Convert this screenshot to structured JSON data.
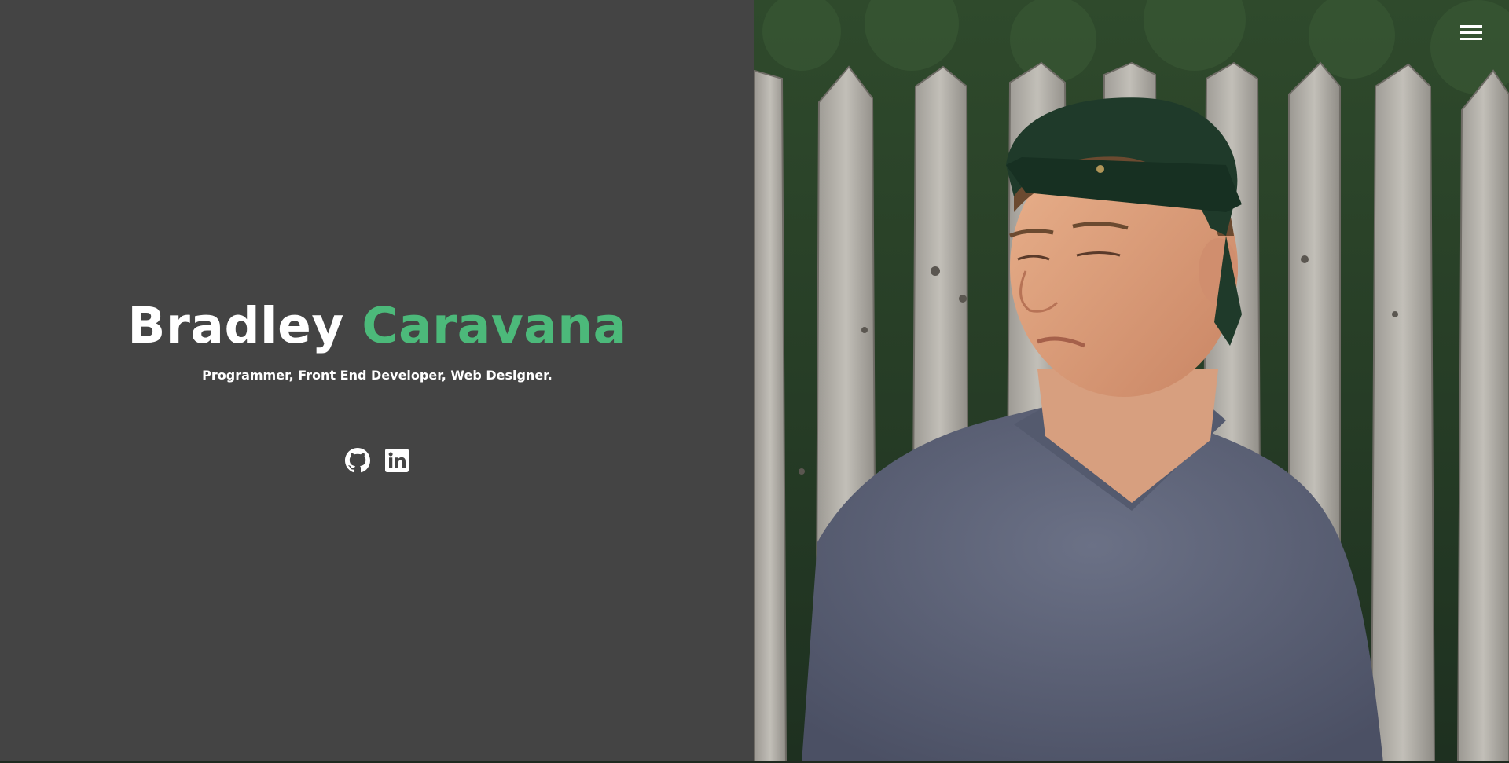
{
  "hero": {
    "first_name": "Bradley",
    "last_name": "Caravana",
    "tagline": "Programmer, Front End Developer, Web Designer."
  },
  "socials": [
    {
      "name": "GitHub",
      "icon": "github-icon"
    },
    {
      "name": "LinkedIn",
      "icon": "linkedin-icon"
    }
  ],
  "menu": {
    "icon": "hamburger-menu-icon"
  },
  "photo": {
    "description_icon": "profile-photo"
  },
  "colors": {
    "background": "#444444",
    "accent": "#4cb97a",
    "text": "#ffffff"
  }
}
